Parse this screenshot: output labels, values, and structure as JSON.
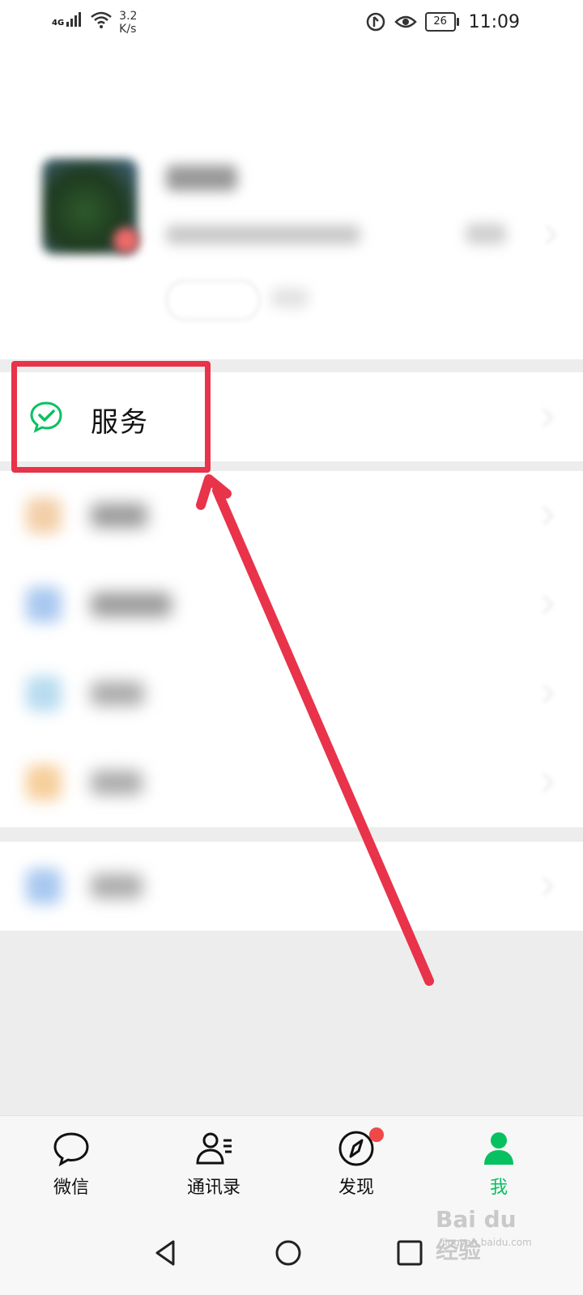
{
  "status_bar": {
    "network": "4G",
    "speed_value": "3.2",
    "speed_unit": "K/s",
    "battery": "26",
    "time": "11:09"
  },
  "menu": {
    "service_label": "服务"
  },
  "tabbar": {
    "items": [
      {
        "label": "微信",
        "icon": "chat-bubble-icon"
      },
      {
        "label": "通讯录",
        "icon": "contacts-icon"
      },
      {
        "label": "发现",
        "icon": "compass-icon",
        "badge": true
      },
      {
        "label": "我",
        "icon": "person-icon",
        "active": true
      }
    ]
  },
  "watermark": {
    "main": "Bai du 经验",
    "sub": "jingyan.baidu.com"
  },
  "colors": {
    "accent_green": "#07c160",
    "highlight_red": "#e8334a",
    "badge_red": "#f04848"
  }
}
